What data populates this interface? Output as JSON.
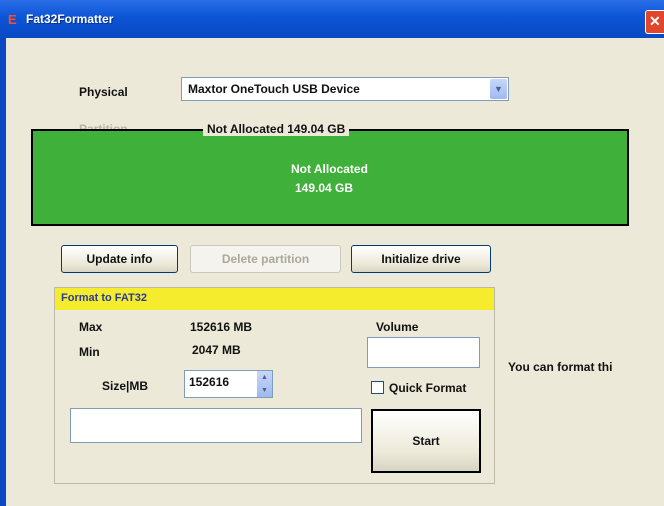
{
  "window": {
    "title": "Fat32Formatter",
    "app_icon": "app-icon",
    "close_icon": "close-icon"
  },
  "drive": {
    "physical_label": "Physical",
    "selected_device": "Maxtor OneTouch USB Device",
    "partition_label": "Partition"
  },
  "partition_map": {
    "caption": "Not Allocated  149.04 GB",
    "segment_label": "Not Allocated",
    "segment_size": "149.04 GB",
    "segment_color": "#3fb13a"
  },
  "actions": {
    "update_info": "Update info",
    "delete_partition": "Delete partition",
    "initialize_drive": "Initialize drive"
  },
  "format": {
    "header": "Format to FAT32",
    "header_color": "#f4ec2d",
    "max_label": "Max",
    "max_value": "152616 MB",
    "min_label": "Min",
    "min_value": "2047 MB",
    "size_label": "Size|MB",
    "size_value": "152616",
    "volume_label": "Volume",
    "volume_value": "",
    "quick_format_label": "Quick Format",
    "quick_format_checked": false,
    "start_label": "Start"
  },
  "side_note": "You can format thi"
}
